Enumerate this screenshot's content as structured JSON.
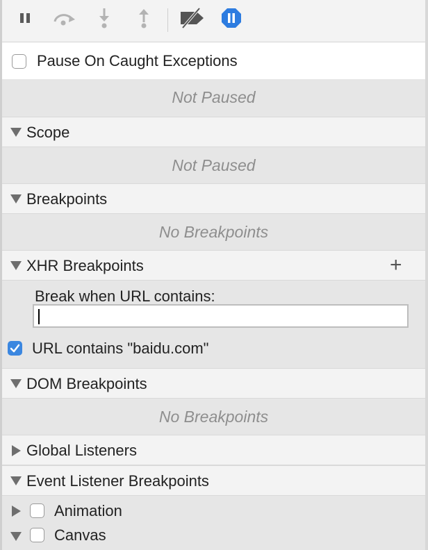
{
  "toolbar": {
    "buttons": [
      {
        "icon": "pause-icon"
      },
      {
        "icon": "step-over-icon"
      },
      {
        "icon": "step-into-icon"
      },
      {
        "icon": "step-out-icon"
      },
      {
        "icon": "deactivate-breakpoints-icon"
      },
      {
        "icon": "pause-on-exceptions-icon"
      }
    ],
    "accent_color": "#2d7ce0"
  },
  "pause_on_caught": {
    "label": "Pause On Caught Exceptions",
    "checked": false
  },
  "call_stack": {
    "empty_text": "Not Paused"
  },
  "scope": {
    "title": "Scope",
    "empty_text": "Not Paused"
  },
  "breakpoints": {
    "title": "Breakpoints",
    "empty_text": "No Breakpoints"
  },
  "xhr_breakpoints": {
    "title": "XHR Breakpoints",
    "add_icon": "plus-icon",
    "input_label": "Break when URL contains:",
    "input_value": "",
    "items": [
      {
        "label": "URL contains \"baidu.com\"",
        "checked": true
      }
    ]
  },
  "dom_breakpoints": {
    "title": "DOM Breakpoints",
    "empty_text": "No Breakpoints"
  },
  "global_listeners": {
    "title": "Global Listeners",
    "expanded": false
  },
  "event_listener_breakpoints": {
    "title": "Event Listener Breakpoints",
    "categories": [
      {
        "label": "Animation",
        "expanded": false,
        "checked": false
      },
      {
        "label": "Canvas",
        "expanded": true,
        "checked": false
      }
    ]
  }
}
